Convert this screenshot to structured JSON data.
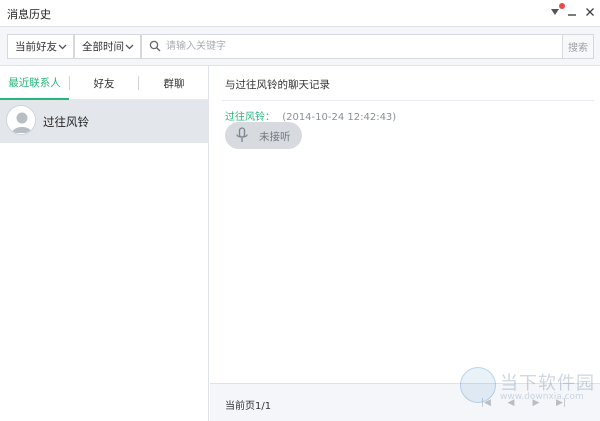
{
  "window": {
    "title": "消息历史"
  },
  "filters": {
    "friend_scope": "当前好友",
    "time_scope": "全部时间",
    "search_placeholder": "请输入关键字",
    "search_button": "搜索"
  },
  "left_tabs": [
    {
      "label": "最近联系人",
      "active": true
    },
    {
      "label": "好友",
      "active": false
    },
    {
      "label": "群聊",
      "active": false
    }
  ],
  "contacts": [
    {
      "name": "过往风铃",
      "selected": true
    }
  ],
  "chat": {
    "title": "与过往风铃的聊天记录",
    "messages": [
      {
        "sender": "过往风铃：",
        "time": "(2014-10-24 12:42:43)",
        "voice_label": "未接听"
      }
    ]
  },
  "footer": {
    "page_label": "当前页1/1"
  },
  "watermark": {
    "text": "当下软件园",
    "url": "www.downxia.com"
  },
  "colors": {
    "accent": "#28b77a",
    "notification_dot": "#e84a4a",
    "selected_row": "#e3e6ea",
    "bar_background": "#f4f6f9"
  },
  "icons": {
    "dropdown": "chevron-down-icon",
    "search": "search-icon",
    "menu": "menu-arrow-icon",
    "minimize": "minimize-icon",
    "close": "close-icon",
    "avatar": "user-avatar-icon",
    "voice": "microphone-icon",
    "first_page": "first-page-icon",
    "prev_page": "prev-page-icon",
    "next_page": "next-page-icon",
    "last_page": "last-page-icon"
  }
}
